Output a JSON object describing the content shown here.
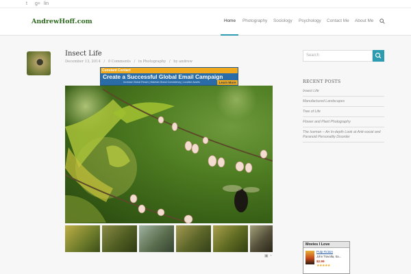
{
  "topbar": {
    "social": [
      {
        "icon": "twitter-icon",
        "glyph": "t"
      },
      {
        "icon": "googleplus-icon",
        "glyph": "g+"
      },
      {
        "icon": "linkedin-icon",
        "glyph": "lin"
      }
    ]
  },
  "header": {
    "logo": "AndrewHoff.com",
    "nav": [
      {
        "label": "Home",
        "active": true
      },
      {
        "label": "Photography"
      },
      {
        "label": "Sociology"
      },
      {
        "label": "Psychology"
      },
      {
        "label": "Contact Me"
      },
      {
        "label": "About Me"
      }
    ],
    "accent_color": "#2d9bb0",
    "search_icon": "search-icon"
  },
  "post": {
    "title": "Insect Life",
    "date": "December 13, 2014",
    "comments": "0 Comments",
    "category": "in Photography",
    "author": "by andrew",
    "separator": "/"
  },
  "ad": {
    "brand": "Constant Contact",
    "headline": "Create a Successful Global Email Campaign",
    "subtext": "Increase Global Reach | Maintain Brand Consistency | Localize Assets",
    "button": "Learn More"
  },
  "sidebar": {
    "search_placeholder": "Search",
    "recent_heading": "RECENT POSTS",
    "recent_posts": [
      "Insect Life",
      "Manufactured Landscapes",
      "Tree of Life",
      "Flower and Plant Photography",
      "The Iceman – An In-depth Look at Anti-social and Paranoid Personality Disorder"
    ]
  },
  "movies": {
    "heading": "Movies I Love",
    "title": "Pulp Fiction",
    "cast": "John Travolta, Sa...",
    "price": "$2.99",
    "stars": "★★★★★"
  }
}
